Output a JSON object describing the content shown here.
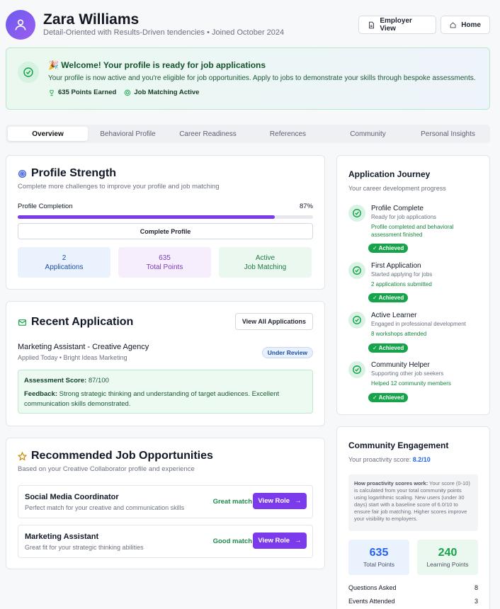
{
  "profile": {
    "name": "Zara Williams",
    "subtitle": "Detail-Oriented with Results-Driven tendencies • Joined October 2024",
    "employer_view_label": "Employer View",
    "home_label": "Home"
  },
  "welcome": {
    "title": "Welcome! Your profile is ready for job applications",
    "text": "Your profile is now active and you're eligible for job opportunities. Apply to jobs to demonstrate your skills through bespoke assessments.",
    "points": "635 Points Earned",
    "matching": "Job Matching Active"
  },
  "tabs": [
    "Overview",
    "Behavioral Profile",
    "Career Readiness",
    "References",
    "Community",
    "Personal Insights"
  ],
  "strength": {
    "title": "Profile Strength",
    "subtitle": "Complete more challenges to improve your profile and job matching",
    "completion_label": "Profile Completion",
    "completion_value": "87%",
    "completion_fraction": 0.87,
    "complete_button": "Complete Profile",
    "stats": [
      {
        "value": "2",
        "label": "Applications"
      },
      {
        "value": "635",
        "label": "Total Points"
      },
      {
        "value": "Active",
        "label": "Job Matching"
      }
    ]
  },
  "recent": {
    "title": "Recent Application",
    "view_all": "View All Applications",
    "job_title": "Marketing Assistant - Creative Agency",
    "job_meta": "Applied Today • Bright Ideas Marketing",
    "status": "Under Review",
    "score_label": "Assessment Score:",
    "score_value": "87/100",
    "feedback_label": "Feedback:",
    "feedback_text": "Strong strategic thinking and understanding of target audiences. Excellent communication skills demonstrated."
  },
  "recommended": {
    "title": "Recommended Job Opportunities",
    "subtitle": "Based on your Creative Collaborator profile and experience",
    "jobs": [
      {
        "title": "Social Media Coordinator",
        "desc": "Perfect match for your creative and communication skills",
        "match": "Great match",
        "button": "View Role"
      },
      {
        "title": "Marketing Assistant",
        "desc": "Great fit for your strategic thinking abilities",
        "match": "Good match",
        "button": "View Role"
      }
    ]
  },
  "journey": {
    "title": "Application Journey",
    "subtitle": "Your career development progress",
    "steps": [
      {
        "title": "Profile Complete",
        "desc": "Ready for job applications",
        "detail": "Profile completed and behavioral assessment finished",
        "badge": "✓ Achieved"
      },
      {
        "title": "First Application",
        "desc": "Started applying for jobs",
        "detail": "2 applications submitted",
        "badge": "✓ Achieved"
      },
      {
        "title": "Active Learner",
        "desc": "Engaged in professional development",
        "detail": "8 workshops attended",
        "badge": "✓ Achieved"
      },
      {
        "title": "Community Helper",
        "desc": "Supporting other job seekers",
        "detail": "Helped 12 community members",
        "badge": "✓ Achieved"
      }
    ]
  },
  "community": {
    "title": "Community Engagement",
    "score_label": "Your proactivity score:",
    "score_value": "8.2/10",
    "how_label": "How proactivity scores work:",
    "how_text": "Your score (0-10) is calculated from your total community points using logarithmic scaling. New users (under 30 days) start with a baseline score of 6.0/10 to ensure fair job matching. Higher scores improve your visibility to employers.",
    "total_points": "635",
    "total_points_label": "Total Points",
    "learning_points": "240",
    "learning_points_label": "Learning Points",
    "rows": [
      {
        "label": "Questions Asked",
        "value": "8"
      },
      {
        "label": "Events Attended",
        "value": "3"
      }
    ]
  }
}
